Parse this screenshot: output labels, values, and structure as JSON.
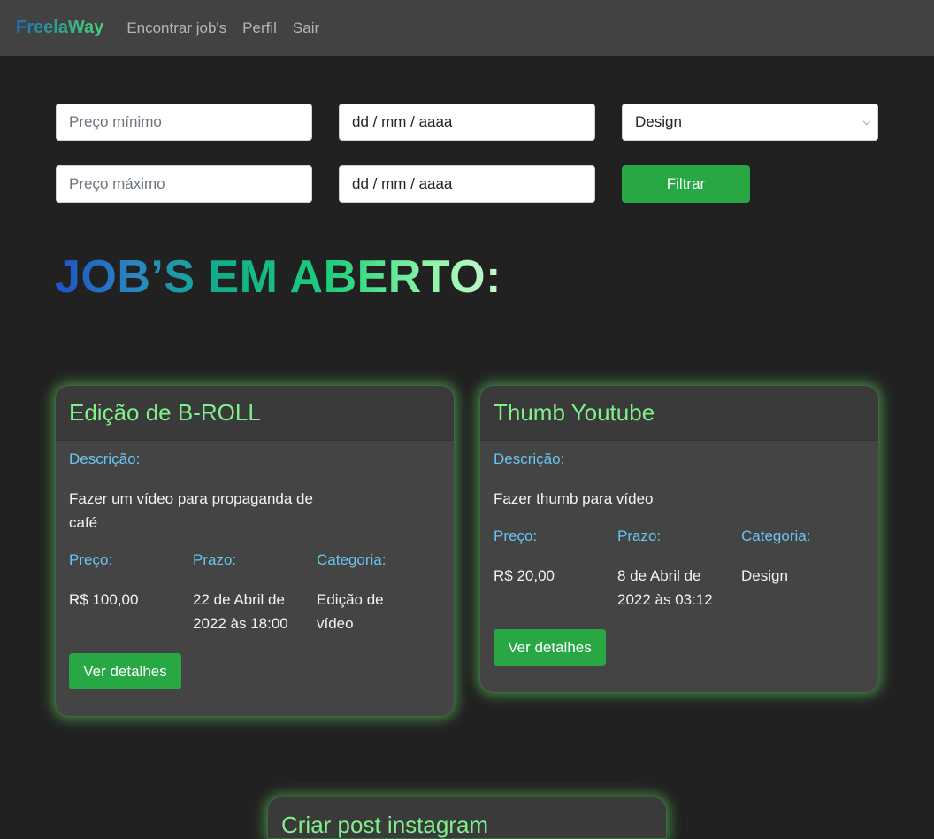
{
  "nav": {
    "brand": "FreelaWay",
    "links": [
      "Encontrar job's",
      "Perfil",
      "Sair"
    ]
  },
  "filters": {
    "min_price_placeholder": "Preço mínimo",
    "max_price_placeholder": "Preço máximo",
    "date_start": "dd / mm / aaaa",
    "date_end": "dd / mm / aaaa",
    "category_selected": "Design",
    "filter_button": "Filtrar"
  },
  "heading": "JOB’S EM ABERTO:",
  "labels": {
    "description": "Descrição:",
    "price": "Preço:",
    "deadline": "Prazo:",
    "category": "Categoria:",
    "details_button": "Ver detalhes"
  },
  "jobs": [
    {
      "title": "Edição de B-ROLL",
      "description": "Fazer um vídeo para propaganda de café",
      "price": "R$ 100,00",
      "deadline": "22 de Abril de 2022 às 18:00",
      "category": "Edição de vídeo"
    },
    {
      "title": "Thumb Youtube",
      "description": "Fazer thumb para vídeo",
      "price": "R$ 20,00",
      "deadline": "8 de Abril de 2022 às 03:12",
      "category": "Design"
    },
    {
      "title": "Criar post instagram"
    }
  ]
}
